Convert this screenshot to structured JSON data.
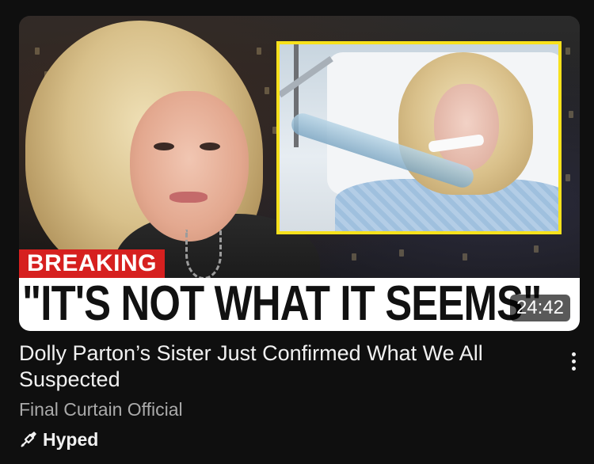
{
  "video": {
    "banner_label": "BREAKING",
    "banner_quote": "\"IT'S NOT WHAT IT SEEMS\"",
    "duration": "24:42",
    "title": "Dolly Parton’s Sister Just Confirmed What We All Suspected",
    "channel": "Final Curtain Official",
    "badge": "Hyped"
  },
  "icons": {
    "hype": "hype-icon",
    "menu": "more-vert-icon"
  },
  "colors": {
    "background": "#0f0f0f",
    "banner_red": "#d6201f",
    "inset_border": "#f7e11c",
    "title_text": "#f1f1f1",
    "meta_text": "#aaaaaa"
  }
}
